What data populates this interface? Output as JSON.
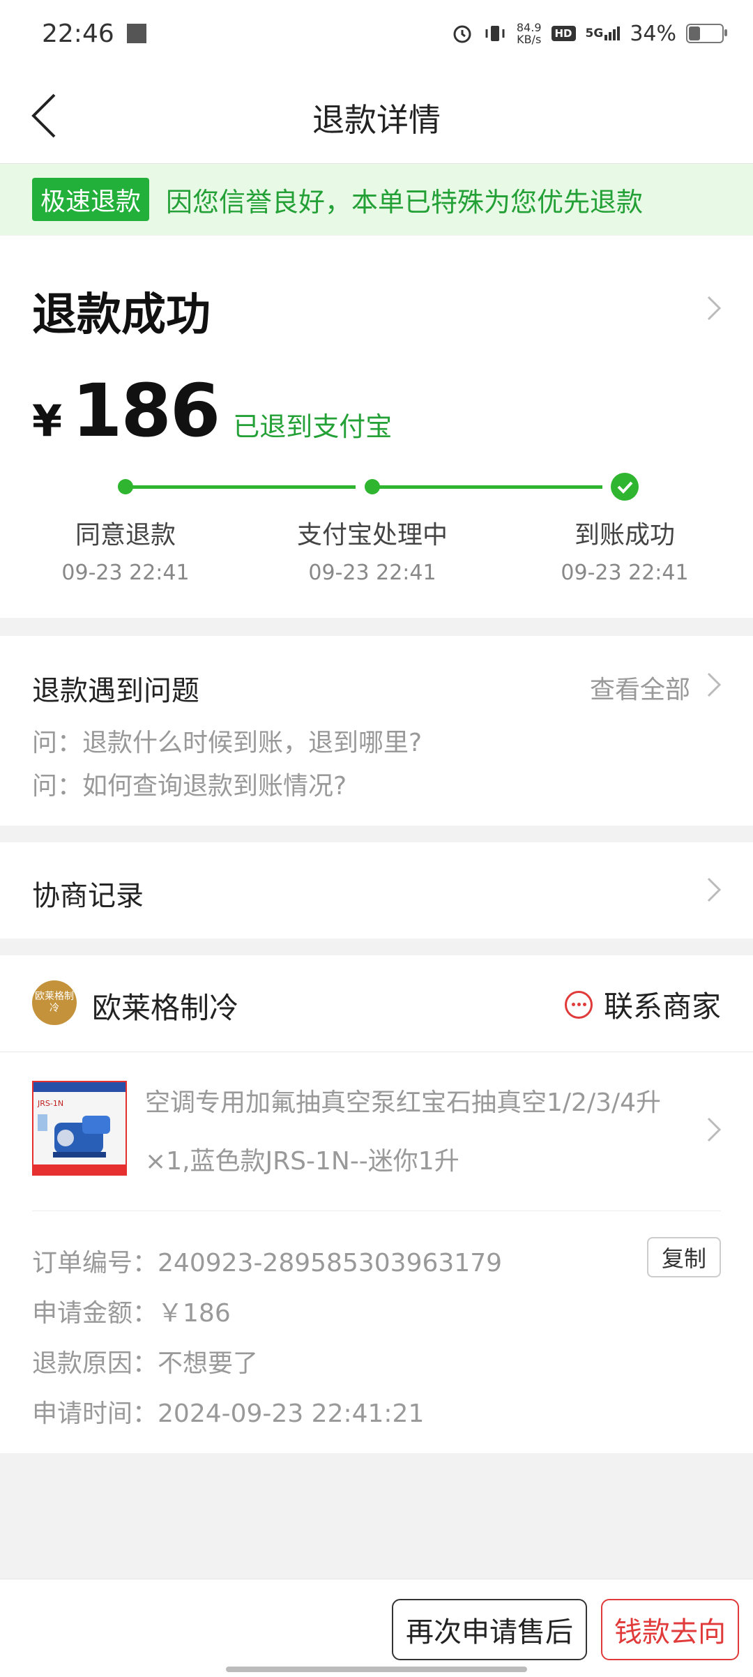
{
  "status_bar": {
    "time": "22:46",
    "speed_value": "84.9",
    "speed_unit": "KB/s",
    "hd": "HD",
    "network": "5G",
    "battery_text": "34%",
    "battery_level": 0.34
  },
  "nav": {
    "title": "退款详情"
  },
  "banner": {
    "tag": "极速退款",
    "message": "因您信誉良好，本单已特殊为您优先退款"
  },
  "refund": {
    "status": "退款成功",
    "currency": "¥",
    "amount": "186",
    "destination": "已退到支付宝",
    "steps": [
      {
        "label": "同意退款",
        "time": "09-23 22:41"
      },
      {
        "label": "支付宝处理中",
        "time": "09-23 22:41"
      },
      {
        "label": "到账成功",
        "time": "09-23 22:41"
      }
    ]
  },
  "problems": {
    "title": "退款遇到问题",
    "view_all": "查看全部",
    "faqs": [
      "问：退款什么时候到账，退到哪里?",
      "问：如何查询退款到账情况?"
    ]
  },
  "negotiation": {
    "title": "协商记录"
  },
  "order": {
    "shop_logo_text": "欧莱格制冷",
    "shop_name": "欧莱格制冷",
    "contact_label": "联系商家",
    "product_title": "空调专用加氟抽真空泵红宝石抽真空1/2/3/4升",
    "product_spec": "×1,蓝色款JRS-1N--迷你1升",
    "product_image_text": "JRS-1N",
    "copy_label": "复制",
    "info": [
      {
        "label": "订单编号：",
        "value": "240923-289585303963179"
      },
      {
        "label": "申请金额：",
        "value": "￥186"
      },
      {
        "label": "退款原因：",
        "value": "不想要了"
      },
      {
        "label": "申请时间：",
        "value": "2024-09-23 22:41:21"
      }
    ]
  },
  "bottom": {
    "reapply_label": "再次申请售后",
    "money_label": "钱款去向"
  },
  "colors": {
    "green": "#2fb52f",
    "banner_bg": "#e8f9e6",
    "red": "#e03a3a"
  }
}
